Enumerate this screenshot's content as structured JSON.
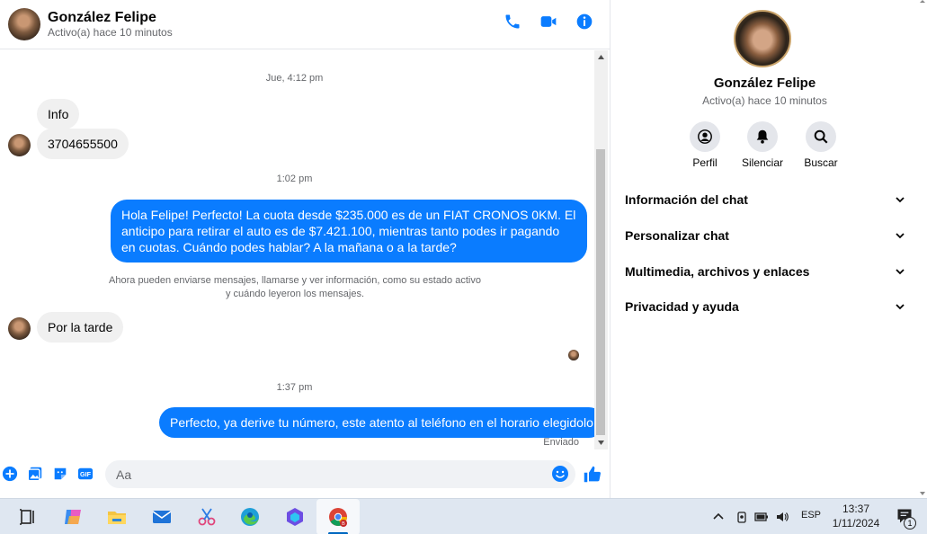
{
  "colors": {
    "accent": "#0a7cff",
    "incoming_bubble": "#f0f0f0",
    "muted_text": "#65676b"
  },
  "header": {
    "contact_name": "González Felipe",
    "status": "Activo(a) hace 10 minutos",
    "icons": [
      "phone-icon",
      "video-call-icon",
      "info-icon"
    ]
  },
  "messages": {
    "time_1": "Jue, 4:12 pm",
    "msg_info": "Info",
    "msg_phone": "3704655500",
    "time_2": "1:02 pm",
    "msg_offer": "Hola Felipe! Perfecto! La cuota desde $235.000 es de un FIAT CRONOS 0KM. El anticipo para retirar el auto es de $7.421.100, mientras tanto podes ir pagando en cuotas. Cuándo podes hablar? A la mañana o a la tarde?",
    "system_line_1": "Ahora pueden enviarse mensajes, llamarse y ver información, como su estado activo",
    "system_line_2": "y cuándo leyeron los mensajes.",
    "msg_afternoon": "Por la tarde",
    "time_3": "1:37 pm",
    "msg_reply": "Perfecto, ya derive tu número, este atento al teléfono en el horario elegidolo",
    "sent_status": "Enviado"
  },
  "composer": {
    "placeholder": "Aa",
    "icons": [
      "plus-icon",
      "image-icon",
      "sticker-icon",
      "gif-icon",
      "emoji-icon",
      "like-icon"
    ]
  },
  "panel": {
    "name": "González Felipe",
    "status": "Activo(a) hace 10 minutos",
    "actions": [
      {
        "label": "Perfil",
        "icon": "profile-icon"
      },
      {
        "label": "Silenciar",
        "icon": "bell-icon"
      },
      {
        "label": "Buscar",
        "icon": "search-icon"
      }
    ],
    "sections": [
      "Información del chat",
      "Personalizar chat",
      "Multimedia, archivos y enlaces",
      "Privacidad y ayuda"
    ]
  },
  "taskbar": {
    "apps": [
      "task-view-icon",
      "copilot-icon",
      "file-explorer-icon",
      "mail-icon",
      "snipping-tool-icon",
      "edge-icon",
      "copilot-app-icon",
      "chrome-icon"
    ],
    "language": "ESP",
    "time": "13:37",
    "date": "1/11/2024",
    "notification_count": "1"
  }
}
